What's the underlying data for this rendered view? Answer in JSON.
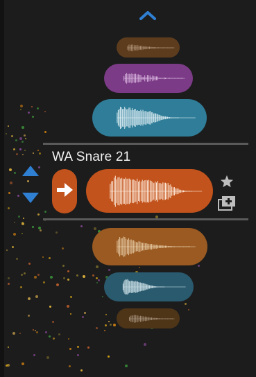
{
  "selected_sample": {
    "name": "WA Snare 21"
  },
  "icons": {
    "scroll_up": "chevron-up-icon",
    "nudge_up": "triangle-up-icon",
    "nudge_down": "triangle-down-icon",
    "send": "arrow-right-icon",
    "favorite": "star-icon",
    "add_to_collection": "library-add-icon"
  },
  "colors": {
    "background": "#1c1c1c",
    "accent_blue": "#2f7fd3",
    "orange": "#c2531c",
    "orange_muted": "#9a5a22",
    "purple": "#8a3f93",
    "teal": "#2f7d98",
    "teal_muted": "#2a5a6e",
    "brown_dark": "#5d3c1e"
  },
  "samples_above": [
    {
      "color": "#5d3c1e"
    },
    {
      "color": "#7b3b86"
    },
    {
      "color": "#2f7d98"
    }
  ],
  "samples_below": [
    {
      "color": "#9a5a22"
    },
    {
      "color": "#2a5a6e"
    },
    {
      "color": "#4e3518"
    }
  ]
}
